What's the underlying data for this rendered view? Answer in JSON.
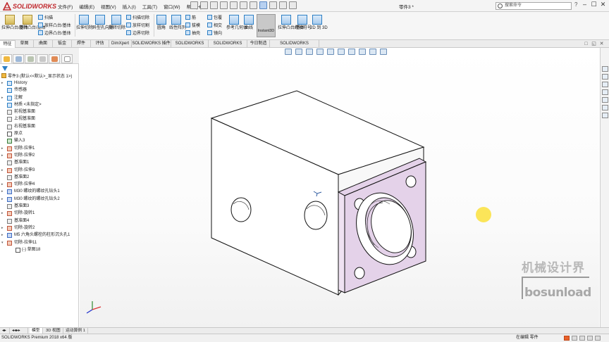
{
  "app": {
    "brand": "SOLIDWORKS",
    "file_title": "零件3 *",
    "help": "?"
  },
  "menu": [
    "文件(F)",
    "编辑(E)",
    "视图(V)",
    "插入(I)",
    "工具(T)",
    "窗口(W)",
    "帮助(H)"
  ],
  "search": {
    "placeholder": "搜索命令"
  },
  "window_controls": [
    "–",
    "☐",
    "✕"
  ],
  "ribbon": {
    "extrude_boss": "拉伸凸台/基体",
    "revolve_boss": "旋转凸台/基体",
    "sweep": "扫描",
    "loft_boss": "放样凸台/基体",
    "boundary_boss": "边界凸台/基体",
    "extrude_cut": "拉伸切除",
    "hole_wizard": "异型孔向导",
    "revolve_cut": "旋转切除",
    "sweep_cut": "扫描切除",
    "loft_cut": "放样切割",
    "boundary_cut": "边界切除",
    "fillet": "圆角",
    "linear_pattern": "线性阵列",
    "rib": "筋",
    "draft": "拔模",
    "shell": "抽壳",
    "wrap": "包覆",
    "intersect": "相交",
    "mirror": "镜向",
    "ref_geometry": "参考几何体",
    "curves": "曲线",
    "instant3d": "Instant3D",
    "extrude_boss2": "拉伸凸台/基体",
    "weld": "焊接符号",
    "to_2d": "2D 到 3D"
  },
  "command_tabs": [
    "特征",
    "草图",
    "曲面",
    "钣金",
    "焊件",
    "评估",
    "DimXpert",
    "SOLIDWORKS 插件",
    "SOLIDWORKS MBD",
    "SOLIDWORKS CAM",
    "今日制造",
    "SOLIDWORKS Inspection"
  ],
  "feature_tree": {
    "root": "零件3 (默认<<默认>_显示状态 1>)",
    "items": [
      {
        "label": "History",
        "icon": "history-icon"
      },
      {
        "label": "传感器",
        "icon": "sensor-icon"
      },
      {
        "label": "注解",
        "icon": "annotation-icon"
      },
      {
        "label": "材质 <未指定>",
        "icon": "material-icon"
      },
      {
        "label": "前视基准面",
        "icon": "plane-icon"
      },
      {
        "label": "上视基准面",
        "icon": "plane-icon"
      },
      {
        "label": "右视基准面",
        "icon": "plane-icon"
      },
      {
        "label": "原点",
        "icon": "origin-icon"
      },
      {
        "label": "输入3",
        "icon": "import-icon"
      },
      {
        "label": "切除-拉伸1",
        "icon": "cut-icon"
      },
      {
        "label": "切除-拉伸2",
        "icon": "cut-icon"
      },
      {
        "label": "基准面1",
        "icon": "plane-icon"
      },
      {
        "label": "切除-拉伸3",
        "icon": "cut-icon"
      },
      {
        "label": "基准面2",
        "icon": "plane-icon"
      },
      {
        "label": "切除-拉伸4",
        "icon": "cut-icon"
      },
      {
        "label": "M30 螺纹的螺纹孔钻头1",
        "icon": "hole-icon"
      },
      {
        "label": "M30 螺纹的螺纹孔钻头2",
        "icon": "hole-icon"
      },
      {
        "label": "基准面3",
        "icon": "plane-icon"
      },
      {
        "label": "切除-旋转1",
        "icon": "cut-icon"
      },
      {
        "label": "基准面4",
        "icon": "plane-icon"
      },
      {
        "label": "切除-旋转2",
        "icon": "cut-icon"
      },
      {
        "label": "M5 六角头螺栓的柱形沉头孔1",
        "icon": "hole-icon"
      },
      {
        "label": "切除-拉伸11",
        "icon": "cut-icon"
      }
    ],
    "sub_item": "(-) 草图18"
  },
  "bottom_tabs": [
    "模型",
    "3D 视图",
    "运动算例 1"
  ],
  "status": {
    "left": "SOLIDWORKS Premium 2018 x64 版",
    "right": "在编辑 零件"
  },
  "watermark": {
    "cn": "机械设计界",
    "en": "bosunload"
  },
  "colors": {
    "accent": "#2d7fc5",
    "face_highlight": "#e4d2e9",
    "brand": "#c0282d"
  }
}
